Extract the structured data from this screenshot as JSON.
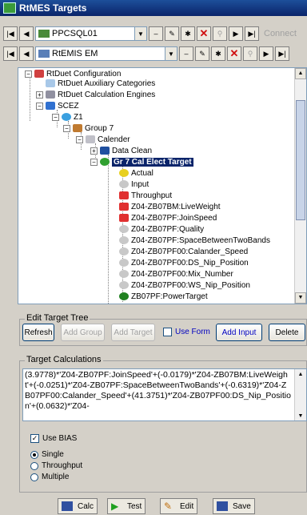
{
  "window": {
    "title": "RtMES Targets"
  },
  "toolbar1": {
    "combo_value": "PPCSQL01",
    "connect_label": "Connect"
  },
  "toolbar2": {
    "combo_value": "RtEMIS EM"
  },
  "tree": {
    "nodes": [
      {
        "label": "RtDuet Configuration"
      },
      {
        "label": "RtDuet Auxiliary Categories"
      },
      {
        "label": "RtDuet Calculation Engines"
      },
      {
        "label": "SCEZ"
      },
      {
        "label": "Z1"
      },
      {
        "label": "Group 7"
      },
      {
        "label": "Calender"
      },
      {
        "label": "Data Clean"
      },
      {
        "label": "Gr 7 Cal Elect Target"
      },
      {
        "label": "Actual"
      },
      {
        "label": "Input"
      },
      {
        "label": "Throughput"
      },
      {
        "label": "Z04-ZB07BM:LiveWeight"
      },
      {
        "label": "Z04-ZB07PF:JoinSpeed"
      },
      {
        "label": "Z04-ZB07PF:Quality"
      },
      {
        "label": "Z04-ZB07PF:SpaceBetweenTwoBands"
      },
      {
        "label": "Z04-ZB07PF00:Calander_Speed"
      },
      {
        "label": "Z04-ZB07PF00:DS_Nip_Position"
      },
      {
        "label": "Z04-ZB07PF00:Mix_Number"
      },
      {
        "label": "Z04-ZB07PF00:WS_Nip_Position"
      },
      {
        "label": "ZB07PF:PowerTarget"
      }
    ]
  },
  "edit_tree": {
    "title": "Edit Target Tree",
    "refresh": "Refresh",
    "add_group": "Add Group",
    "add_target": "Add Target",
    "use_form": "Use Form",
    "add_input": "Add Input",
    "delete": "Delete"
  },
  "calc": {
    "title": "Target Calculations",
    "text": "(3.9778)*'Z04-ZB07PF:JoinSpeed'+(-0.0179)*'Z04-ZB07BM:LiveWeight'+(-0.0251)*'Z04-ZB07PF:SpaceBetweenTwoBands'+(-0.6319)*'Z04-ZB07PF00:Calander_Speed'+(41.3751)*'Z04-ZB07PF00:DS_Nip_Position'+(0.0632)*'Z04-",
    "use_bias": "Use BIAS",
    "use_bias_checked": true,
    "options": [
      "Single",
      "Throughput",
      "Multiple"
    ],
    "selected": "Single"
  },
  "bottom": {
    "calc": "Calc",
    "test": "Test",
    "edit": "Edit",
    "save": "Save"
  }
}
